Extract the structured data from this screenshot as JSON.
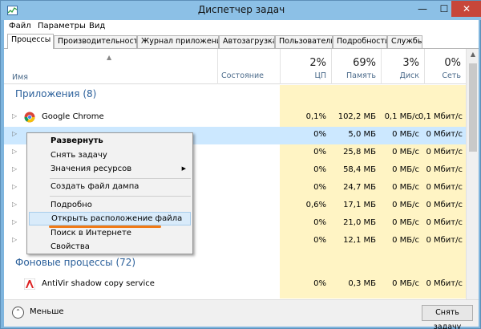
{
  "window": {
    "title": "Диспетчер задач",
    "minimize": "—",
    "maximize": "☐",
    "close": "✕"
  },
  "menu": [
    "Файл",
    "Параметры",
    "Вид"
  ],
  "tabs": [
    "Процессы",
    "Производительность",
    "Журнал приложений",
    "Автозагрузка",
    "Пользователи",
    "Подробности",
    "Службы"
  ],
  "header": {
    "name": "Имя",
    "state": "Состояние",
    "cpu": {
      "pct": "2%",
      "label": "ЦП"
    },
    "memory": {
      "pct": "69%",
      "label": "Память"
    },
    "disk": {
      "pct": "3%",
      "label": "Диск"
    },
    "net": {
      "pct": "0%",
      "label": "Сеть"
    }
  },
  "groups": {
    "apps": "Приложения (8)",
    "background": "Фоновые процессы (72)"
  },
  "rows": [
    {
      "name": "Google Chrome",
      "cpu": "0,1%",
      "mem": "102,2 МБ",
      "disk": "0,1 МБ/с",
      "net": "0,1 Мбит/с"
    },
    {
      "name": "",
      "cpu": "0%",
      "mem": "5,0 МБ",
      "disk": "0 МБ/с",
      "net": "0 Мбит/с"
    },
    {
      "name": "",
      "cpu": "0%",
      "mem": "25,8 МБ",
      "disk": "0 МБ/с",
      "net": "0 Мбит/с"
    },
    {
      "name": "",
      "cpu": "0%",
      "mem": "58,4 МБ",
      "disk": "0 МБ/с",
      "net": "0 Мбит/с"
    },
    {
      "name": "",
      "cpu": "0%",
      "mem": "24,7 МБ",
      "disk": "0 МБ/с",
      "net": "0 Мбит/с"
    },
    {
      "name": "",
      "cpu": "0,6%",
      "mem": "17,1 МБ",
      "disk": "0 МБ/с",
      "net": "0 Мбит/с"
    },
    {
      "name": "",
      "cpu": "0%",
      "mem": "21,0 МБ",
      "disk": "0 МБ/с",
      "net": "0 Мбит/с"
    },
    {
      "name": "",
      "cpu": "0%",
      "mem": "12,1 МБ",
      "disk": "0 МБ/с",
      "net": "0 Мбит/с"
    },
    {
      "name": "AntiVir shadow copy service",
      "cpu": "0%",
      "mem": "0,3 МБ",
      "disk": "0 МБ/с",
      "net": "0 Мбит/с"
    }
  ],
  "context_menu": {
    "items": [
      "Развернуть",
      "Снять задачу",
      "Значения ресурсов",
      "Создать файл дампа",
      "Подробно",
      "Открыть расположение файла",
      "Поиск в Интернете",
      "Свойства"
    ],
    "submenu_arrow": "▶"
  },
  "footer": {
    "fewer": "Меньше",
    "end_task": "Снять задачу"
  },
  "colors": {
    "accent": "#2a5f9a",
    "highlight_mark": "#f07a16",
    "usage_fill": "#fff4c4"
  }
}
